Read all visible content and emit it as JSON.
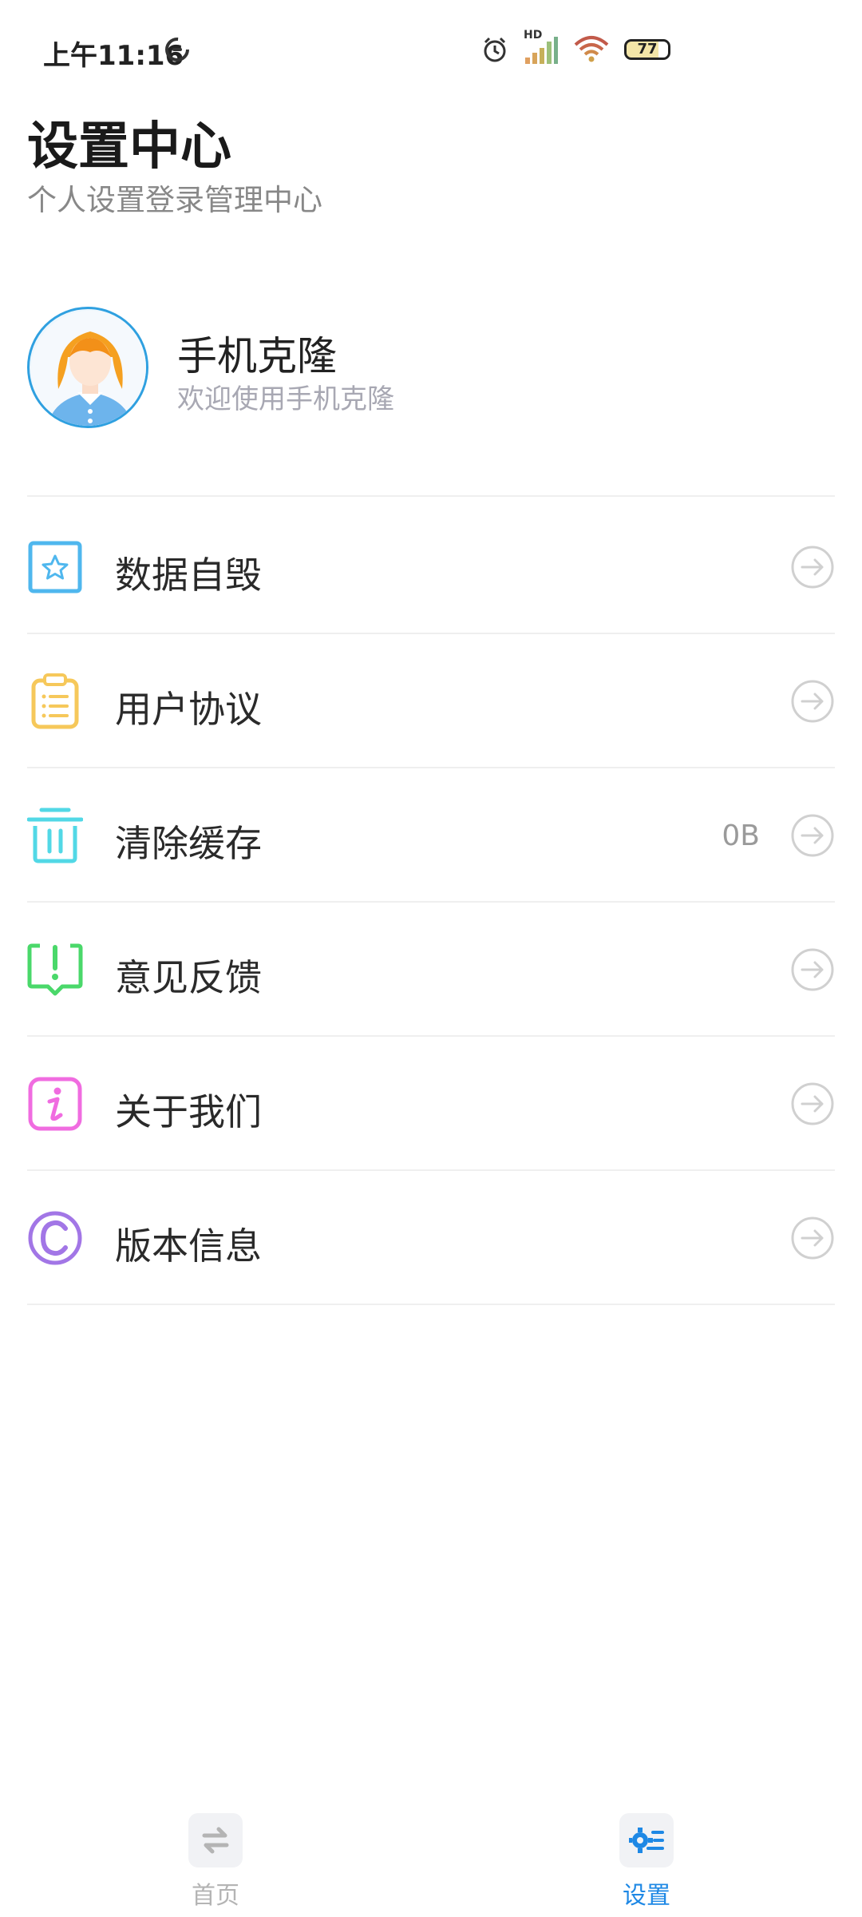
{
  "status_bar": {
    "time": "上午11:16",
    "battery": "77",
    "network_badge": "HD",
    "icons": [
      "sync-icon",
      "alarm-icon",
      "signal-icon",
      "wifi-icon",
      "battery-icon"
    ]
  },
  "header": {
    "title": "设置中心",
    "subtitle": "个人设置登录管理中心"
  },
  "profile": {
    "name": "手机克隆",
    "description": "欢迎使用手机克隆"
  },
  "menu": {
    "items": [
      {
        "label": "数据自毁",
        "value": "",
        "icon": "star-box-icon",
        "color": "#4fb7ee"
      },
      {
        "label": "用户协议",
        "value": "",
        "icon": "clipboard-icon",
        "color": "#f6c85a"
      },
      {
        "label": "清除缓存",
        "value": "0B",
        "icon": "trash-icon",
        "color": "#52d8e6"
      },
      {
        "label": "意见反馈",
        "value": "",
        "icon": "feedback-icon",
        "color": "#4ad86a"
      },
      {
        "label": "关于我们",
        "value": "",
        "icon": "info-icon",
        "color": "#f06ce0"
      },
      {
        "label": "版本信息",
        "value": "",
        "icon": "copyright-icon",
        "color": "#a276e6"
      }
    ]
  },
  "bottom_nav": {
    "items": [
      {
        "label": "首页",
        "icon": "swap-icon",
        "active": false
      },
      {
        "label": "设置",
        "icon": "settings-icon",
        "active": true
      }
    ]
  },
  "colors": {
    "accent": "#1e88e5",
    "inactive": "#b4b4b4",
    "arrow": "#d0d0d0"
  }
}
